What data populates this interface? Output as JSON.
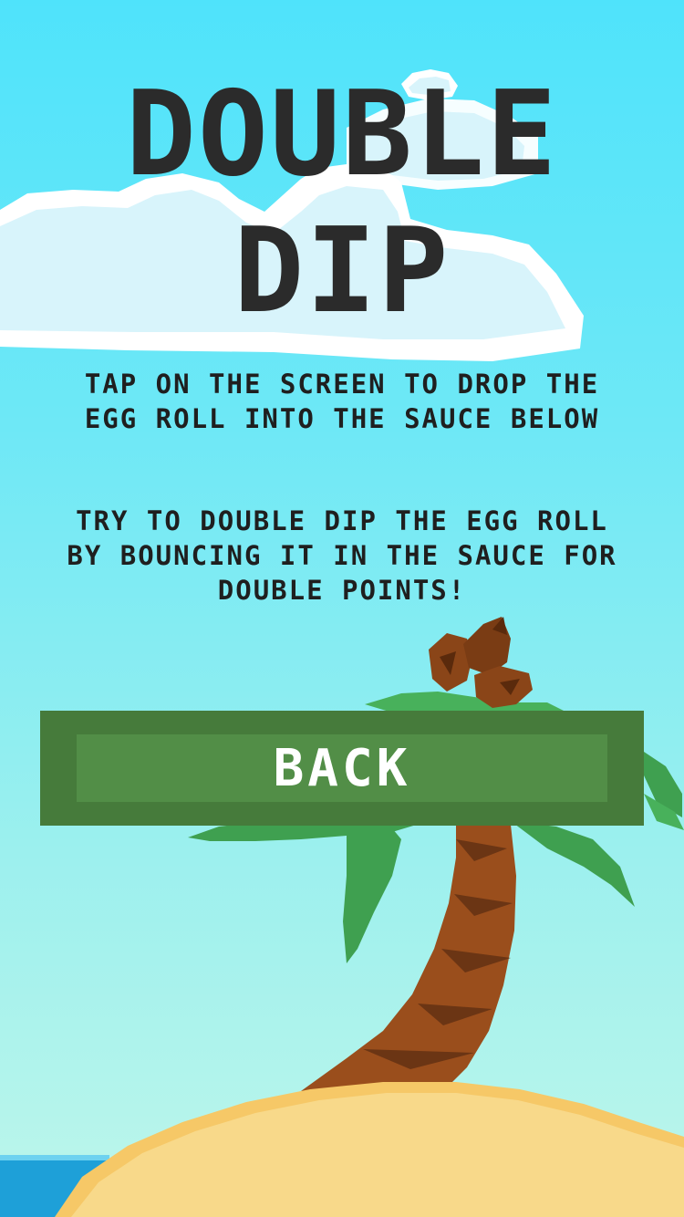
{
  "game": {
    "title_line_1": "DOUBLE",
    "title_line_2": "DIP",
    "instructions": [
      "TAP ON THE SCREEN TO DROP THE EGG ROLL INTO THE SAUCE BELOW",
      "TRY TO DOUBLE DIP THE EGG ROLL BY BOUNCING IT IN THE SAUCE FOR DOUBLE POINTS!"
    ],
    "back_label": "BACK"
  },
  "colors": {
    "sky_top": "#4fe3fb",
    "sky_bottom": "#bef6ea",
    "title_text": "#2b2b2b",
    "button_outer": "#467b3b",
    "button_inner": "#528e47",
    "sand": "#f8d98a",
    "sand_edge": "#f6c867",
    "trunk": "#9a4e1c",
    "frond": "#3fa050",
    "ocean": "#1ea0d8"
  }
}
